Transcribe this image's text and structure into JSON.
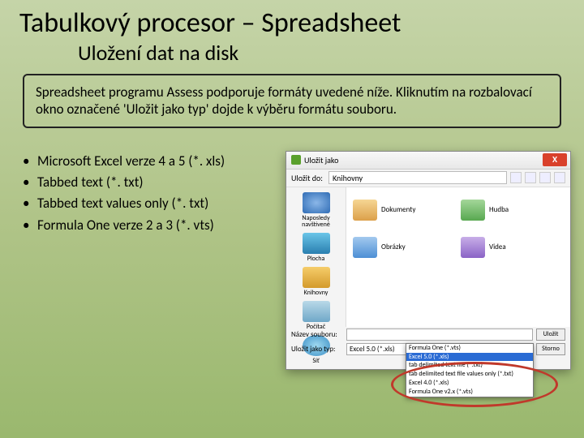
{
  "title": "Tabulkový procesor – Spreadsheet",
  "subtitle": "Uložení dat na disk",
  "description": "Spreadsheet programu Assess podporuje formáty uvedené níže. Kliknutím na rozbalovací okno označené 'Uložit jako typ' dojde k výběru formátu souboru.",
  "bullets": [
    "Microsoft Excel verze 4 a 5 (*. xls)",
    "Tabbed text (*. txt)",
    "Tabbed text values only (*. txt)",
    "Formula One verze 2 a 3 (*. vts)"
  ],
  "dialog": {
    "title": "Uložit jako",
    "close": "X",
    "save_in_label": "Uložit do:",
    "save_in_value": "Knihovny",
    "sidebar": [
      "Naposledy navštívené",
      "Plocha",
      "Knihovny",
      "Počítač",
      "Síť"
    ],
    "libraries": [
      "Dokumenty",
      "Hudba",
      "Obrázky",
      "Videa"
    ],
    "filename_label": "Název souboru:",
    "filename_value": "",
    "type_label": "Uložit jako typ:",
    "type_value": "Excel 5.0 (*.xls)",
    "save_btn": "Uložit",
    "cancel_btn": "Storno",
    "dropdown": [
      "Formula One (*.vts)",
      "Excel 5.0 (*.xls)",
      "tab delimited text file (*.txt)",
      "tab delimited text file values only (*.txt)",
      "Excel 4.0 (*.xls)",
      "Formula One v2.x (*.vts)"
    ],
    "dropdown_selected_index": 1
  }
}
